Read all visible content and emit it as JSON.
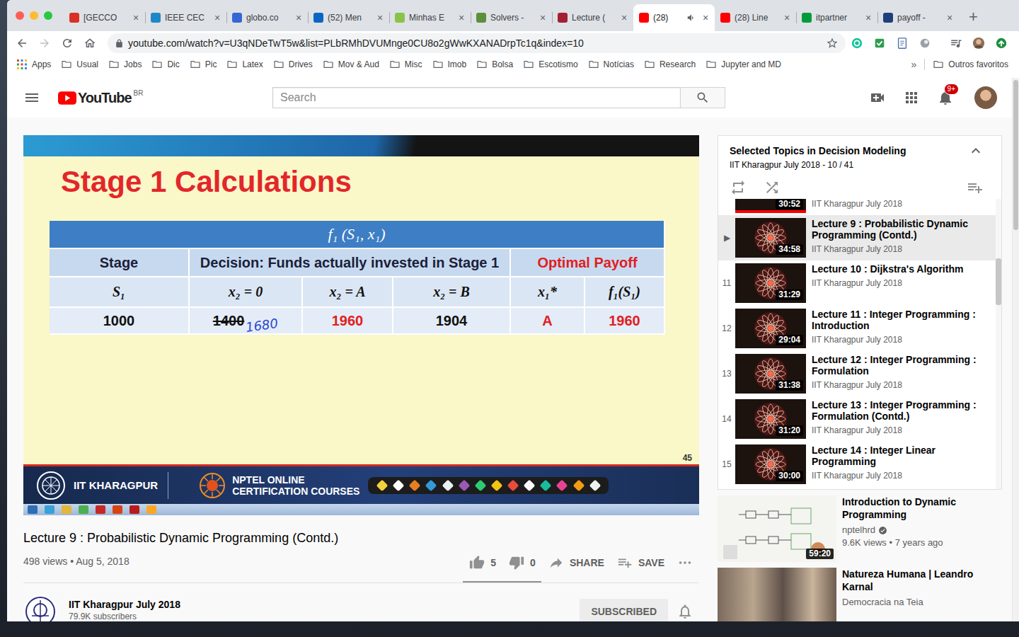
{
  "browser": {
    "window_controls": [
      {
        "color": "#fe5f57"
      },
      {
        "color": "#febc2e"
      },
      {
        "color": "#28c840"
      }
    ],
    "tabs": [
      {
        "label": "[GECCO",
        "selected": false,
        "audio": false,
        "color": "#d93025"
      },
      {
        "label": "IEEE CEC",
        "selected": false,
        "audio": false,
        "color": "#1e88c7"
      },
      {
        "label": "globo.co",
        "selected": false,
        "audio": false,
        "color": "#3367d6"
      },
      {
        "label": "(52) Men",
        "selected": false,
        "audio": false,
        "color": "#0a66c2"
      },
      {
        "label": "Minhas E",
        "selected": false,
        "audio": false,
        "color": "#8bc34a"
      },
      {
        "label": "Solvers -",
        "selected": false,
        "audio": false,
        "color": "#5a8f3c"
      },
      {
        "label": "Lecture (",
        "selected": false,
        "audio": false,
        "color": "#a31f34"
      },
      {
        "label": "(28)",
        "selected": true,
        "audio": true,
        "color": "#ff0000"
      },
      {
        "label": "(28) Line",
        "selected": false,
        "audio": false,
        "color": "#ff0000"
      },
      {
        "label": "itpartner",
        "selected": false,
        "audio": false,
        "color": "#009c3b"
      },
      {
        "label": "payoff -",
        "selected": false,
        "audio": false,
        "color": "#1f3f7a"
      }
    ],
    "tab_close": "×",
    "new_tab": "+",
    "navigation": {
      "back_disabled": false,
      "forward_disabled": true
    },
    "address": {
      "url": "youtube.com/watch?v=U3qNDeTwT5w&list=PLbRMhDVUMnge0CU8o2gWwKXANADrpTc1q&index=10",
      "secure": true,
      "bookmarked": false
    },
    "bookmarks": [
      {
        "label": "Apps",
        "kind": "apps"
      },
      {
        "label": "Usual",
        "kind": "folder"
      },
      {
        "label": "Jobs",
        "kind": "folder"
      },
      {
        "label": "Dic",
        "kind": "folder"
      },
      {
        "label": "Pic",
        "kind": "folder"
      },
      {
        "label": "Latex",
        "kind": "folder"
      },
      {
        "label": "Drives",
        "kind": "folder"
      },
      {
        "label": "Mov & Aud",
        "kind": "folder"
      },
      {
        "label": "Misc",
        "kind": "folder"
      },
      {
        "label": "Imob",
        "kind": "folder"
      },
      {
        "label": "Bolsa",
        "kind": "folder"
      },
      {
        "label": "Escotismo",
        "kind": "folder"
      },
      {
        "label": "Notícias",
        "kind": "folder"
      },
      {
        "label": "Research",
        "kind": "folder"
      },
      {
        "label": "Jupyter and MD",
        "kind": "folder"
      }
    ],
    "bookmarks_overflow": "»",
    "other_bookmarks": "Outros favoritos"
  },
  "youtube": {
    "logo": "YouTube",
    "region": "BR",
    "search_placeholder": "Search",
    "notification_count": "9+"
  },
  "video": {
    "slide": {
      "title": "Stage 1 Calculations",
      "table": {
        "caption": "f₁ (S₁, x₁)",
        "header_groups": [
          {
            "label": "Stage",
            "span": 1,
            "highlighted": false
          },
          {
            "label": "Decision: Funds actually invested in Stage 1",
            "span": 3,
            "highlighted": false
          },
          {
            "label": "Optimal Payoff",
            "span": 2,
            "highlighted": true
          }
        ],
        "columns": [
          "S₁",
          "x₂ = 0",
          "x₂ = A",
          "x₂ = B",
          "x₁*",
          "f₁(S₁)"
        ],
        "rows": [
          [
            {
              "text": "1000",
              "highlighted": false,
              "struck": false
            },
            {
              "text": "1400",
              "highlighted": false,
              "struck": true,
              "annotation": "1680"
            },
            {
              "text": "1960",
              "highlighted": true,
              "struck": false
            },
            {
              "text": "1904",
              "highlighted": false,
              "struck": false
            },
            {
              "text": "A",
              "highlighted": true,
              "struck": false
            },
            {
              "text": "1960",
              "highlighted": true,
              "struck": false
            }
          ]
        ]
      },
      "page": "45"
    },
    "footer": {
      "institute": "IIT KHARAGPUR",
      "course_line1": "NPTEL ONLINE",
      "course_line2": "CERTIFICATION COURSES"
    }
  },
  "details": {
    "title": "Lecture 9 : Probabilistic Dynamic Programming (Contd.)",
    "stats": "498 views • Aug 5, 2018",
    "likes": "5",
    "dislikes": "0",
    "like_ratio": 1,
    "share": "SHARE",
    "save": "SAVE",
    "channel": {
      "name": "IIT Kharagpur July 2018",
      "subscribers": "79.9K subscribers",
      "subscribe_label": "SUBSCRIBED",
      "subscribed": true
    }
  },
  "playlist": {
    "title": "Selected Topics in Decision Modeling",
    "subtitle": "IIT Kharagpur July 2018 - 10 / 41",
    "expanded": true,
    "items": [
      {
        "kind": "partial",
        "channel": "IIT Kharagpur July 2018",
        "duration": "30:52",
        "progress": 1,
        "selected": false
      },
      {
        "kind": "video",
        "index": "▶",
        "title": "Lecture 9 : Probabilistic Dynamic Programming (Contd.)",
        "channel": "IIT Kharagpur July 2018",
        "duration": "34:58",
        "progress": 0,
        "selected": true
      },
      {
        "kind": "video",
        "index": "11",
        "title": "Lecture 10 : Dijkstra's Algorithm",
        "channel": "IIT Kharagpur July 2018",
        "duration": "31:29",
        "progress": 0,
        "selected": false
      },
      {
        "kind": "video",
        "index": "12",
        "title": "Lecture 11 : Integer Programming : Introduction",
        "channel": "IIT Kharagpur July 2018",
        "duration": "29:04",
        "progress": 0,
        "selected": false
      },
      {
        "kind": "video",
        "index": "13",
        "title": "Lecture 12 : Integer Programming : Formulation",
        "channel": "IIT Kharagpur July 2018",
        "duration": "31:38",
        "progress": 0,
        "selected": false
      },
      {
        "kind": "video",
        "index": "14",
        "title": "Lecture 13 : Integer Programming : Formulation (Contd.)",
        "channel": "IIT Kharagpur July 2018",
        "duration": "31:20",
        "progress": 0,
        "selected": false
      },
      {
        "kind": "video",
        "index": "15",
        "title": "Lecture 14 : Integer Linear Programming",
        "channel": "IIT Kharagpur July 2018",
        "duration": "30:00",
        "progress": 0,
        "selected": false
      }
    ]
  },
  "recommended": [
    {
      "kind": "diagram",
      "title": "Introduction to Dynamic Programming",
      "channel": "nptelhrd",
      "verified": true,
      "meta": "9.6K views • 7 years ago",
      "duration": "59:20"
    },
    {
      "kind": "photo",
      "title": "Natureza Humana | Leandro Karnal",
      "channel": "Democracia na Teia",
      "verified": false
    }
  ]
}
